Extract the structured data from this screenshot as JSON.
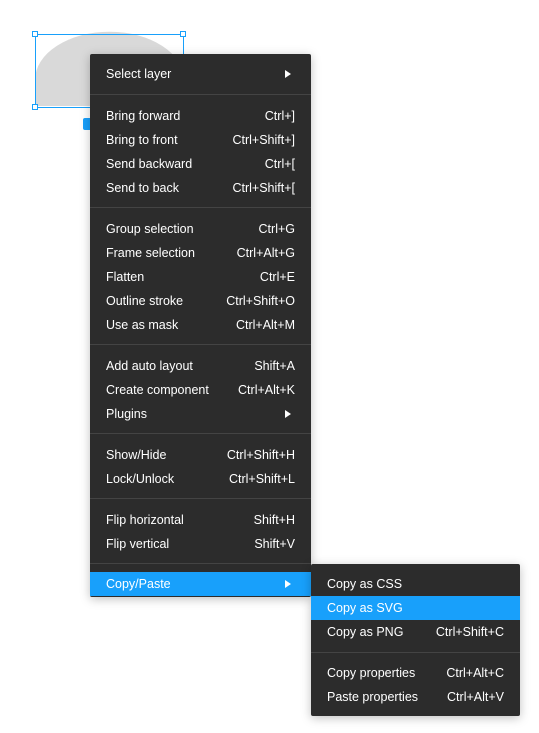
{
  "colors": {
    "menu_bg": "#2c2c2c",
    "highlight": "#18a0fb",
    "separator": "#444444",
    "shape_fill": "#d9d9d9",
    "selection": "#18a0fb"
  },
  "main_menu": {
    "items": [
      {
        "label": "Select layer",
        "shortcut": "",
        "submenu": true
      },
      {
        "label": "Bring forward",
        "shortcut": "Ctrl+]"
      },
      {
        "label": "Bring to front",
        "shortcut": "Ctrl+Shift+]"
      },
      {
        "label": "Send backward",
        "shortcut": "Ctrl+["
      },
      {
        "label": "Send to back",
        "shortcut": "Ctrl+Shift+["
      },
      {
        "label": "Group selection",
        "shortcut": "Ctrl+G"
      },
      {
        "label": "Frame selection",
        "shortcut": "Ctrl+Alt+G"
      },
      {
        "label": "Flatten",
        "shortcut": "Ctrl+E"
      },
      {
        "label": "Outline stroke",
        "shortcut": "Ctrl+Shift+O"
      },
      {
        "label": "Use as mask",
        "shortcut": "Ctrl+Alt+M"
      },
      {
        "label": "Add auto layout",
        "shortcut": "Shift+A"
      },
      {
        "label": "Create component",
        "shortcut": "Ctrl+Alt+K"
      },
      {
        "label": "Plugins",
        "shortcut": "",
        "submenu": true
      },
      {
        "label": "Show/Hide",
        "shortcut": "Ctrl+Shift+H"
      },
      {
        "label": "Lock/Unlock",
        "shortcut": "Ctrl+Shift+L"
      },
      {
        "label": "Flip horizontal",
        "shortcut": "Shift+H"
      },
      {
        "label": "Flip vertical",
        "shortcut": "Shift+V"
      },
      {
        "label": "Copy/Paste",
        "shortcut": "",
        "submenu": true,
        "active": true
      }
    ]
  },
  "sub_menu": {
    "items": [
      {
        "label": "Copy as CSS",
        "shortcut": ""
      },
      {
        "label": "Copy as SVG",
        "shortcut": "",
        "active": true
      },
      {
        "label": "Copy as PNG",
        "shortcut": "Ctrl+Shift+C"
      },
      {
        "label": "Copy properties",
        "shortcut": "Ctrl+Alt+C"
      },
      {
        "label": "Paste properties",
        "shortcut": "Ctrl+Alt+V"
      }
    ]
  }
}
